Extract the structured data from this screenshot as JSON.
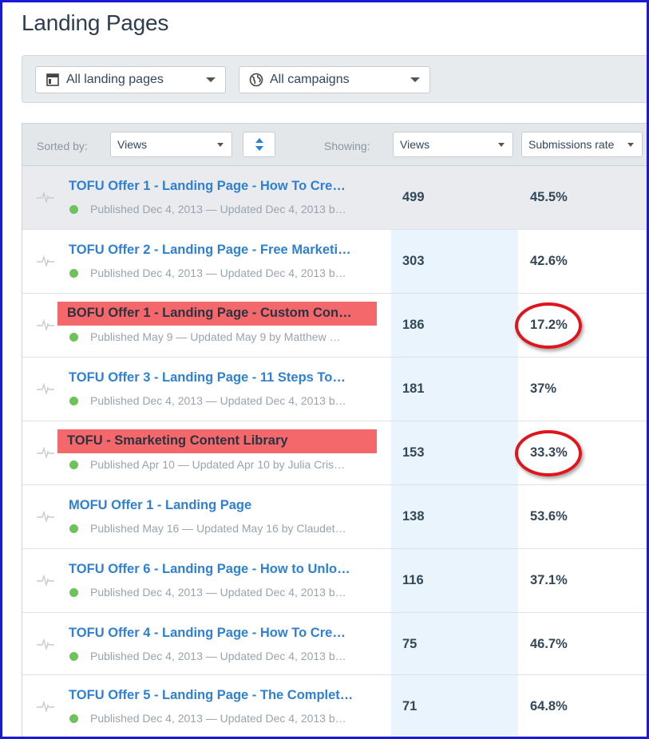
{
  "page": {
    "title": "Landing Pages"
  },
  "filters": {
    "pages_dropdown": {
      "label": "All landing pages",
      "icon": "layout-icon"
    },
    "campaigns_dropdown": {
      "label": "All campaigns",
      "icon": "globe-icon"
    }
  },
  "table_header": {
    "sorted_by_label": "Sorted by:",
    "sort_value": "Views",
    "showing_label": "Showing:",
    "column1_value": "Views",
    "column2_value": "Submissions rate"
  },
  "rows": [
    {
      "title": "TOFU Offer 1 - Landing Page - How To Cre…",
      "meta": "Published Dec 4, 2013 — Updated Dec 4, 2013 b…",
      "views": "499",
      "rate": "45.5%"
    },
    {
      "title": "TOFU Offer 2 - Landing Page - Free Marketi…",
      "meta": "Published Dec 4, 2013 — Updated Dec 4, 2013 b…",
      "views": "303",
      "rate": "42.6%"
    },
    {
      "title": "BOFU Offer 1 - Landing Page - Custom Con…",
      "meta": "Published May 9 — Updated May 9 by Matthew …",
      "views": "186",
      "rate": "17.2%"
    },
    {
      "title": "TOFU Offer 3 - Landing Page - 11 Steps To…",
      "meta": "Published Dec 4, 2013 — Updated Dec 4, 2013 b…",
      "views": "181",
      "rate": "37%"
    },
    {
      "title": "TOFU - Smarketing Content Library",
      "meta": "Published Apr 10 — Updated Apr 10 by Julia Cris…",
      "views": "153",
      "rate": "33.3%"
    },
    {
      "title": "MOFU Offer 1 - Landing Page",
      "meta": "Published May 16 — Updated May 16 by Claudet…",
      "views": "138",
      "rate": "53.6%"
    },
    {
      "title": "TOFU Offer 6 - Landing Page - How to Unlo…",
      "meta": "Published Dec 4, 2013 — Updated Dec 4, 2013 b…",
      "views": "116",
      "rate": "37.1%"
    },
    {
      "title": "TOFU Offer 4 - Landing Page - How To Cre…",
      "meta": "Published Dec 4, 2013 — Updated Dec 4, 2013 b…",
      "views": "75",
      "rate": "46.7%"
    },
    {
      "title": "TOFU Offer 5 - Landing Page - The Complet…",
      "meta": "Published Dec 4, 2013 — Updated Dec 4, 2013 b…",
      "views": "71",
      "rate": "64.8%"
    }
  ],
  "colors": {
    "link": "#2f80d1",
    "marker_fill": "#f4676a",
    "circle_annotation": "#e0141b",
    "published_dot": "#6cc35a",
    "frame_border": "#1a1ad6"
  }
}
